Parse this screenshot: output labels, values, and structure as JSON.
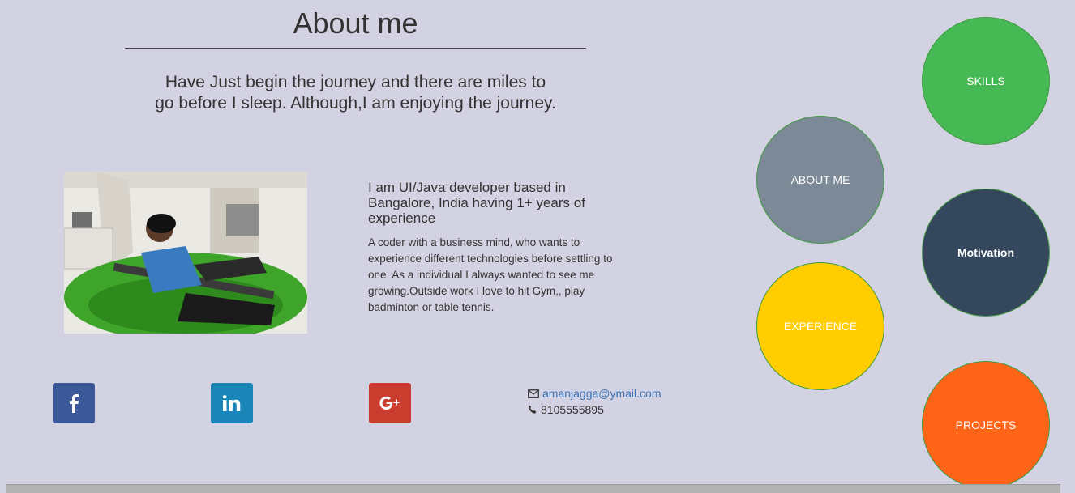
{
  "header": {
    "title": "About me",
    "tagline_line1": "Have Just begin the journey and there are miles to",
    "tagline_line2": "go before I sleep. Although,I am enjoying the journey."
  },
  "profile": {
    "intro": "I am UI/Java developer based in Bangalore, India having 1+ years of experience",
    "description": "A coder with a business mind, who wants to experience different technologies before settling to one. As a individual I always wanted to see me growing.Outside work I love to hit Gym,, play badminton or table tennis."
  },
  "social": {
    "facebook_icon": "facebook-icon",
    "linkedin_icon": "linkedin-icon",
    "googleplus_icon": "google-plus-icon"
  },
  "contact": {
    "email": "amanjagga@ymail.com",
    "phone": "8105555895",
    "email_icon": "envelope-icon",
    "phone_icon": "phone-icon"
  },
  "nav": {
    "skills": "SKILLS",
    "about": "ABOUT ME",
    "motivation": "Motivation",
    "experience": "EXPERIENCE",
    "projects": "PROJECTS"
  },
  "colors": {
    "background": "#d3d2e2",
    "skills": "#44b954",
    "about": "#7c8a97",
    "motivation": "#34475d",
    "experience": "#ffcd00",
    "projects": "#ff6519",
    "facebook": "#3b5998",
    "linkedin": "#1a86b8",
    "googleplus": "#c93c2e",
    "link": "#3a73b6"
  }
}
